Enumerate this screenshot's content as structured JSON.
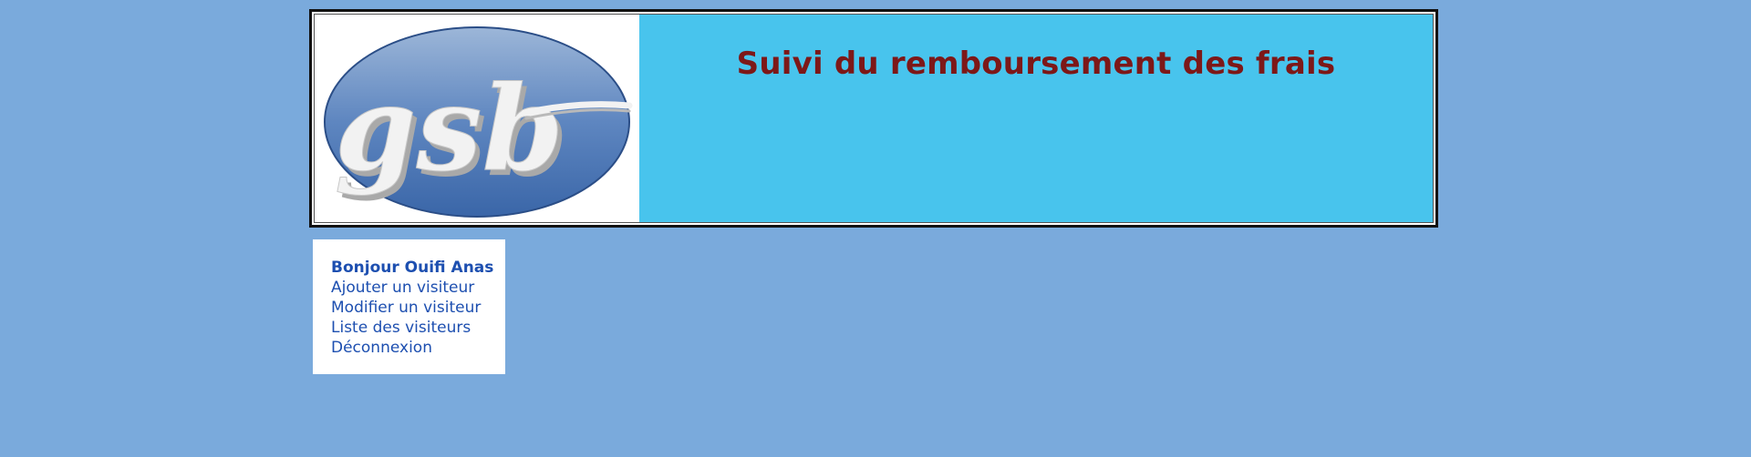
{
  "header": {
    "title": "Suivi du remboursement des frais",
    "logo_text": "gsb",
    "colors": {
      "banner_background": "#48c4ed",
      "title_color": "#7d1818",
      "page_background": "#7aaadc",
      "menu_text": "#1d4fb0"
    }
  },
  "menu": {
    "greeting": "Bonjour Ouifi Anas",
    "items": [
      {
        "label": "Ajouter un visiteur"
      },
      {
        "label": "Modifier un visiteur"
      },
      {
        "label": "Liste des visiteurs"
      },
      {
        "label": "Déconnexion"
      }
    ]
  }
}
